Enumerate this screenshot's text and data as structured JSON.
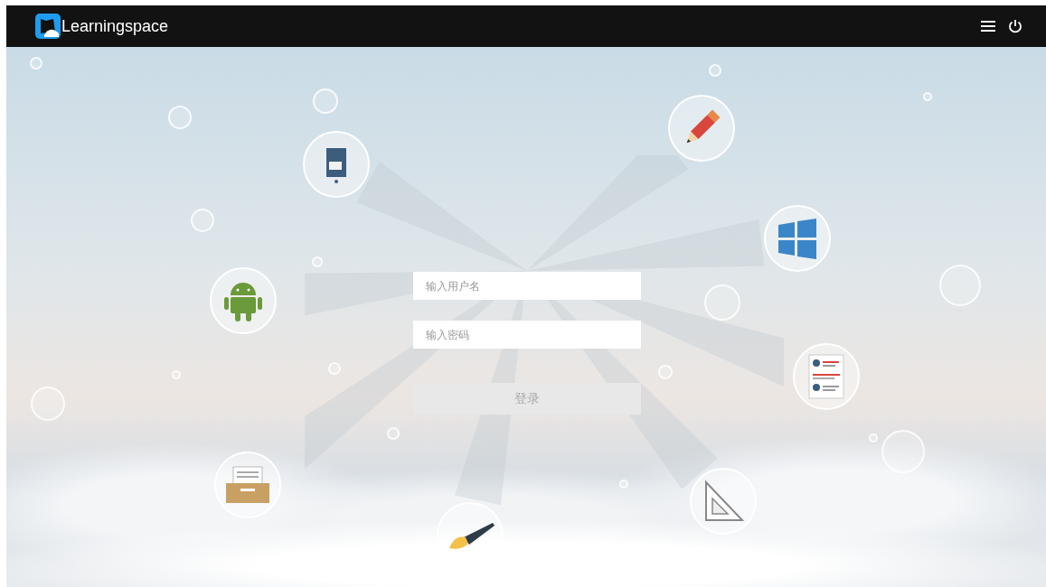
{
  "header": {
    "brand": "Learningspace"
  },
  "login_form": {
    "username": {
      "placeholder": "输入用户名"
    },
    "password": {
      "placeholder": "输入密码"
    },
    "login_button": {
      "label": "登录",
      "disabled": true
    }
  }
}
